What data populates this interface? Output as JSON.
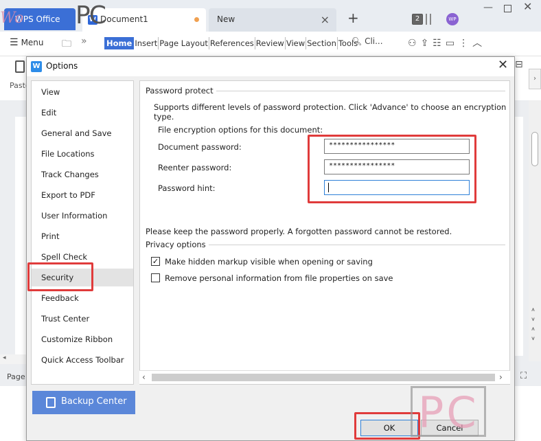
{
  "app": {
    "tabs": {
      "wps": "WPS Office",
      "document": "Document1",
      "new": "New",
      "count": "2",
      "avatar": "WP"
    },
    "watermark": {
      "left": "PC",
      "brand": "PC"
    }
  },
  "ribbon": {
    "menu_label": "Menu",
    "tabs": [
      "Home",
      "Insert",
      "Page Layout",
      "References",
      "Review",
      "View",
      "Section",
      "Tools"
    ],
    "search_label": "Cli..."
  },
  "background": {
    "paste_label": "Paste",
    "status_page": "Page"
  },
  "dialog": {
    "title": "Options",
    "nav_items": [
      "View",
      "Edit",
      "General and Save",
      "File Locations",
      "Track Changes",
      "Export to PDF",
      "User Information",
      "Print",
      "Spell Check",
      "Security",
      "Feedback",
      "Trust Center",
      "Customize Ribbon",
      "Quick Access Toolbar"
    ],
    "active_nav": "Security",
    "password_protect": {
      "group_label": "Password protect",
      "description": "Supports different levels of password protection. Click 'Advance' to choose an encryption type.",
      "file_options_label": "File encryption options for this document:",
      "document_password_label": "Document password:",
      "document_password_value": "****************",
      "reenter_password_label": "Reenter password:",
      "reenter_password_value": "****************",
      "password_hint_label": "Password hint:",
      "password_hint_value": "",
      "warning": "Please keep the password properly. A forgotten password cannot be restored."
    },
    "privacy_options": {
      "group_label": "Privacy options",
      "items": [
        {
          "label": "Make hidden markup visible when opening or saving",
          "checked": true
        },
        {
          "label": "Remove personal information from file properties on save",
          "checked": false
        }
      ]
    },
    "backup_center_label": "Backup Center",
    "ok_label": "OK",
    "cancel_label": "Cancel"
  },
  "colors": {
    "accent": "#3b6fd6",
    "highlight_red": "#e03b3b",
    "backup_button": "#5b87d9"
  }
}
